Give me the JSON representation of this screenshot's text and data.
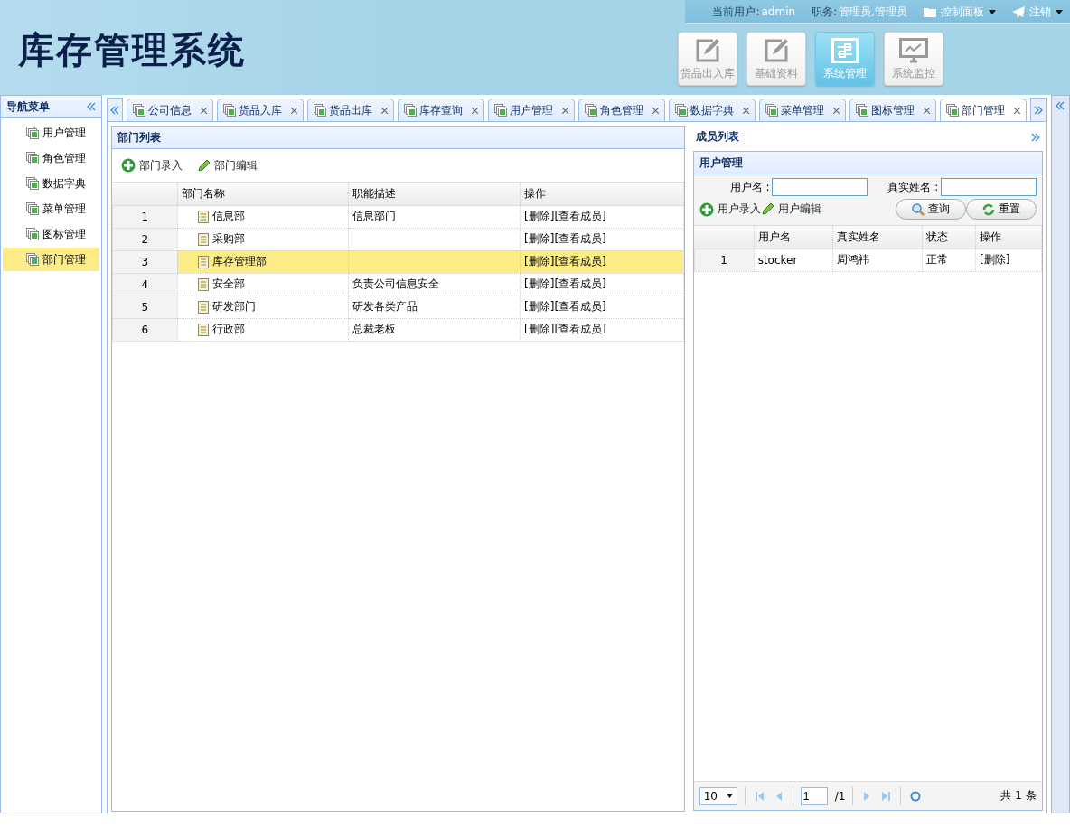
{
  "header": {
    "title": "库存管理系统",
    "user_label": "当前用户:",
    "user": "admin",
    "role_label": "职务:",
    "role": "管理员,管理员",
    "menus": [
      {
        "label": "控制面板",
        "kind": "folder"
      },
      {
        "label": "注销",
        "kind": "send"
      }
    ],
    "modules": [
      {
        "label": "货品出入库",
        "kind": "edit",
        "selected": false
      },
      {
        "label": "基础资料",
        "kind": "edit",
        "selected": false
      },
      {
        "label": "系统管理",
        "kind": "sliders",
        "selected": true
      },
      {
        "label": "系统监控",
        "kind": "monitor",
        "selected": false
      }
    ]
  },
  "sidebar": {
    "title": "导航菜单",
    "items": [
      {
        "label": "用户管理",
        "selected": false
      },
      {
        "label": "角色管理",
        "selected": false
      },
      {
        "label": "数据字典",
        "selected": false
      },
      {
        "label": "菜单管理",
        "selected": false
      },
      {
        "label": "图标管理",
        "selected": false
      },
      {
        "label": "部门管理",
        "selected": true
      }
    ]
  },
  "tabs": [
    {
      "label": "公司信息",
      "selected": false
    },
    {
      "label": "货品入库",
      "selected": false
    },
    {
      "label": "货品出库",
      "selected": false
    },
    {
      "label": "库存查询",
      "selected": false
    },
    {
      "label": "用户管理",
      "selected": false
    },
    {
      "label": "角色管理",
      "selected": false
    },
    {
      "label": "数据字典",
      "selected": false
    },
    {
      "label": "菜单管理",
      "selected": false
    },
    {
      "label": "图标管理",
      "selected": false
    },
    {
      "label": "部门管理",
      "selected": true
    }
  ],
  "dept_panel": {
    "title": "部门列表",
    "actions": [
      {
        "label": "部门录入",
        "kind": "add"
      },
      {
        "label": "部门编辑",
        "kind": "edit"
      }
    ],
    "columns": [
      "部门名称",
      "职能描述",
      "操作"
    ],
    "rows": [
      {
        "index": "1",
        "name": "信息部",
        "description": "信息部门",
        "delete": "[删除]",
        "view": "[查看成员]",
        "selected": false
      },
      {
        "index": "2",
        "name": "采购部",
        "delete": "[删除]",
        "view": "[查看成员]",
        "selected": false
      },
      {
        "index": "3",
        "name": "库存管理部",
        "delete": "[删除]",
        "view": "[查看成员]",
        "selected": true
      },
      {
        "index": "4",
        "name": "安全部",
        "description": "负责公司信息安全",
        "delete": "[删除]",
        "view": "[查看成员]",
        "selected": false
      },
      {
        "index": "5",
        "name": "研发部门",
        "description": "研发各类产品",
        "delete": "[删除]",
        "view": "[查看成员]",
        "selected": false
      },
      {
        "index": "6",
        "name": "行政部",
        "description": "总裁老板",
        "delete": "[删除]",
        "view": "[查看成员]",
        "selected": false
      }
    ]
  },
  "member_panel": {
    "title": "成员列表",
    "inner_title": "用户管理",
    "filters": [
      {
        "label": "用户名 :"
      },
      {
        "label": "真实姓名 :"
      }
    ],
    "actions": [
      {
        "label": "用户录入",
        "kind": "add"
      },
      {
        "label": "用户编辑",
        "kind": "edit"
      }
    ],
    "buttons": [
      {
        "label": "查询",
        "kind": "search"
      },
      {
        "label": "重置",
        "kind": "reset"
      }
    ],
    "columns": [
      "用户名",
      "真实姓名",
      "状态",
      "操作"
    ],
    "rows": [
      {
        "index": "1",
        "username": "stocker",
        "real_name": "周鸿祎",
        "status": "正常",
        "delete": "[删除]"
      }
    ],
    "pager": {
      "page_size": "10",
      "page": "1",
      "total_pages": "/1",
      "summary": "共 1 条"
    }
  }
}
